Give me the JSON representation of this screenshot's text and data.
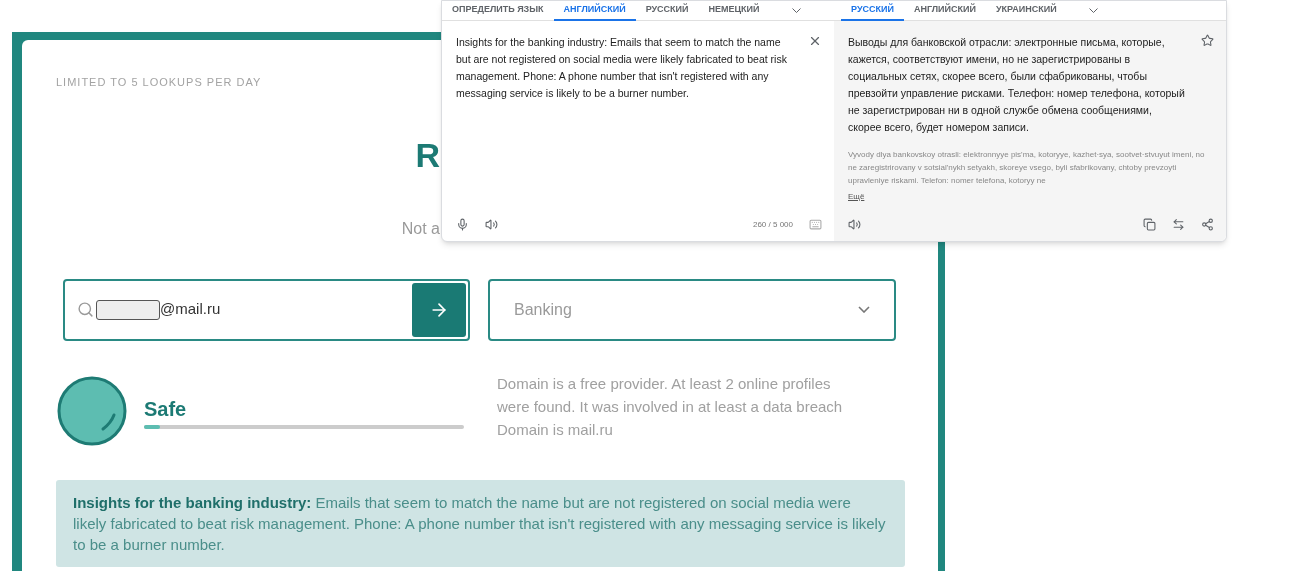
{
  "lookup_card": {
    "limit_note": "LIMITED TO 5 LOOKUPS PER DAY",
    "heading": "R",
    "subtitle": "Not a",
    "email_field": {
      "value": "@mail.ru"
    },
    "industry_select": {
      "value": "Banking"
    },
    "result": {
      "label": "Safe",
      "level": 0.05,
      "details": [
        "Domain is a free provider. At least 2 online profiles",
        "were found. It was involved in at least a data breach",
        "Domain is mail.ru"
      ]
    },
    "insight": "**Insights for the banking industry:** Emails that seem to match the name but are not registered on social media were likely fabricated to beat risk management. Phone: A phone number that isn't registered with any messaging service is likely to be a burner number."
  },
  "translator": {
    "source_tabs": [
      {
        "label": "ОПРЕДЕЛИТЬ ЯЗЫК",
        "selected": false
      },
      {
        "label": "АНГЛИЙСКИЙ",
        "selected": true
      },
      {
        "label": "РУССКИЙ",
        "selected": false
      },
      {
        "label": "НЕМЕЦКИЙ",
        "selected": false
      }
    ],
    "target_tabs": [
      {
        "label": "РУССКИЙ",
        "selected": true
      },
      {
        "label": "АНГЛИЙСКИЙ",
        "selected": false
      },
      {
        "label": "УКРАИНСКИЙ",
        "selected": false
      }
    ],
    "source_text": "Insights for the banking industry: Emails that seem to match the name but are not registered on social media were likely fabricated to beat risk management. Phone: A phone number that isn't registered with any messaging service is likely to be a burner number.",
    "char_count": "260 / 5 000",
    "translation": "Выводы для банковской отрасли: электронные письма, которые, кажется, соответствуют имени, но не зарегистрированы в социальных сетях, скорее всего, были сфабрикованы, чтобы превзойти управление рисками. Телефон: номер телефона, который не зарегистрирован ни в одной службе обмена сообщениями, скорее всего, будет номером записи.",
    "transliteration": "Vyvody dlya bankovskoy otrasli: elektronnyye pis'ma, kotoryye, kazhet·sya, sootvet·stvuyut imeni, no ne zaregistrirovany v sotsial'nykh setyakh, skoreye vsego, byli sfabrikovany, chtoby prevzoyti upravleniye riskami. Telefon: nomer telefona, kotoryy ne",
    "more_link": "Ещё"
  }
}
